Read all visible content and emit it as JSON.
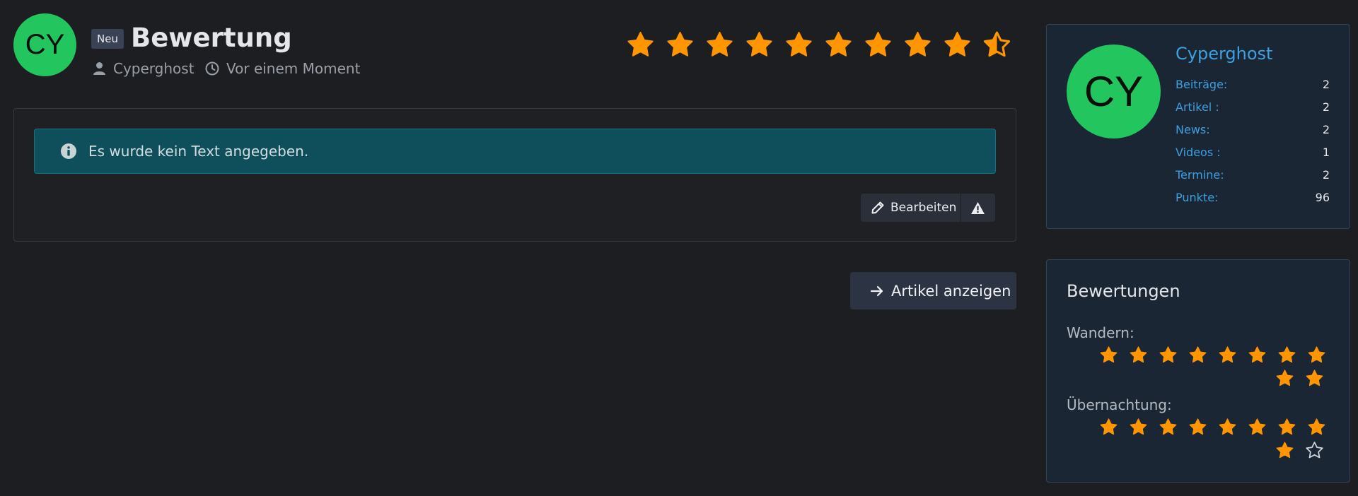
{
  "review": {
    "avatar_initials": "CY",
    "badge": "Neu",
    "title": "Bewertung",
    "author": "Cyperghost",
    "time": "Vor einem Moment",
    "rating_stars": 9.5,
    "rating_max": 10,
    "message": "Es wurde kein Text angegeben.",
    "edit_label": "Bearbeiten",
    "show_article_label": "Artikel anzeigen"
  },
  "profile": {
    "avatar_initials": "CY",
    "name": "Cyperghost",
    "stats": [
      {
        "label": "Beiträge:",
        "value": "2"
      },
      {
        "label": "Artikel :",
        "value": "2"
      },
      {
        "label": "News:",
        "value": "2"
      },
      {
        "label": "Videos :",
        "value": "1"
      },
      {
        "label": "Termine:",
        "value": "2"
      },
      {
        "label": "Punkte:",
        "value": "96"
      }
    ]
  },
  "ratings": {
    "title": "Bewertungen",
    "categories": [
      {
        "label": "Wandern:",
        "filled": 10,
        "max": 10
      },
      {
        "label": "Übernachtung:",
        "filled": 9,
        "max": 10
      }
    ]
  },
  "colors": {
    "star": "#ff9500",
    "avatar": "#22c55e",
    "link": "#3da0e0",
    "info": "#0f4f5c"
  },
  "icons": [
    "user-icon",
    "clock-icon",
    "info-icon",
    "pencil-icon",
    "warning-icon",
    "arrow-right-icon",
    "star-icon"
  ]
}
